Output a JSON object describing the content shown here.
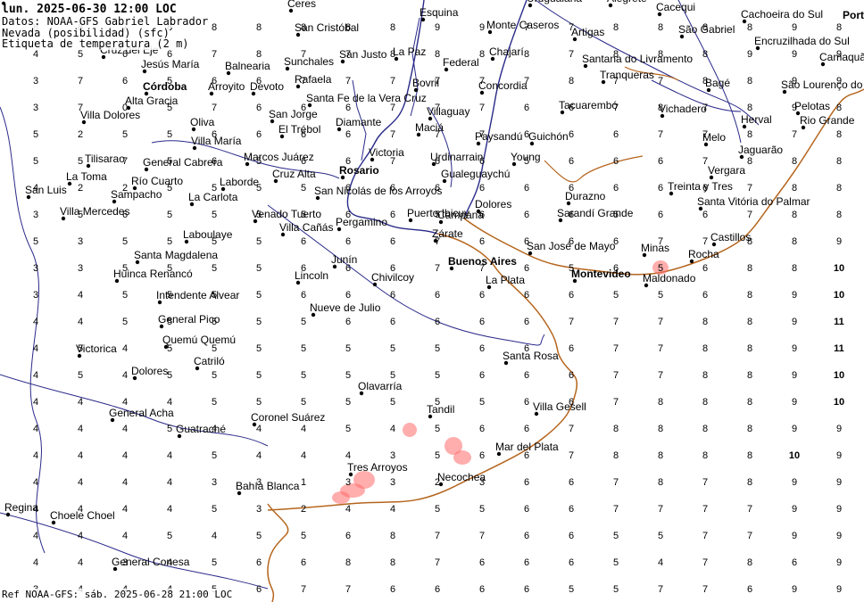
{
  "header": {
    "line1": "lun. 2025-06-30 12:00 LOC",
    "line2": "Datos: NOAA-GFS  Gabriel Labrador",
    "line3": "Nevada (posibilidad) (sfc)",
    "line4": "Etiqueta de temperatura (2 m)"
  },
  "footer": "Ref NOAA-GFS: sáb. 2025-06-28 21:00 LOC",
  "corner_label": "Port",
  "colors": {
    "background": "#ffffff",
    "river": "#2a2a8a",
    "coast": "#b5651d",
    "snow": "#ff6a6a",
    "city_dot": "#000000",
    "text": "#000000"
  },
  "cities": [
    {
      "name": "Ceres",
      "major": false
    },
    {
      "name": "Esquina",
      "major": false
    },
    {
      "name": "Uruguaiana",
      "major": false
    },
    {
      "name": "Alegrete",
      "major": false
    },
    {
      "name": "Cacequi",
      "major": false
    },
    {
      "name": "Cachoeira do Sul",
      "major": false
    },
    {
      "name": "San Cristóbal",
      "major": false
    },
    {
      "name": "Monte Caseros",
      "major": false
    },
    {
      "name": "Artigas",
      "major": false
    },
    {
      "name": "São Gabriel",
      "major": false
    },
    {
      "name": "Encruzilhada do Sul",
      "major": false
    },
    {
      "name": "Cruz del Eje",
      "major": false
    },
    {
      "name": "San Justo",
      "major": false
    },
    {
      "name": "La Paz",
      "major": false
    },
    {
      "name": "Chajarí",
      "major": false
    },
    {
      "name": "Camaquã",
      "major": false
    },
    {
      "name": "Jesús María",
      "major": false
    },
    {
      "name": "Balnearia",
      "major": false
    },
    {
      "name": "Sunchales",
      "major": false
    },
    {
      "name": "Federal",
      "major": false
    },
    {
      "name": "Santana do Livramento",
      "major": false
    },
    {
      "name": "Córdoba",
      "major": true
    },
    {
      "name": "Arroyito",
      "major": false
    },
    {
      "name": "Devoto",
      "major": false
    },
    {
      "name": "Rafaela",
      "major": false
    },
    {
      "name": "Bovril",
      "major": false
    },
    {
      "name": "Concordia",
      "major": false
    },
    {
      "name": "Tranqueras",
      "major": false
    },
    {
      "name": "Bagé",
      "major": false
    },
    {
      "name": "São Lourenço do",
      "major": false
    },
    {
      "name": "Alta Gracia",
      "major": false
    },
    {
      "name": "Santa Fe de la Vera Cruz",
      "major": false
    },
    {
      "name": "Villaguay",
      "major": false
    },
    {
      "name": "Tacuarembó",
      "major": false
    },
    {
      "name": "Pelotas",
      "major": false
    },
    {
      "name": "Villa Dolores",
      "major": false
    },
    {
      "name": "San Jorge",
      "major": false
    },
    {
      "name": "Vichadero",
      "major": false
    },
    {
      "name": "Herval",
      "major": false
    },
    {
      "name": "Rio Grande",
      "major": false
    },
    {
      "name": "Oliva",
      "major": false
    },
    {
      "name": "Diamante",
      "major": false
    },
    {
      "name": "Maciá",
      "major": false
    },
    {
      "name": "Mina Clavero",
      "major": false
    },
    {
      "name": "El Trébol",
      "major": false
    },
    {
      "name": "Paysandú",
      "major": false
    },
    {
      "name": "Guichón",
      "major": false
    },
    {
      "name": "Melo",
      "major": false
    },
    {
      "name": "Villa María",
      "major": false
    },
    {
      "name": "Jaguarão",
      "major": false
    },
    {
      "name": "Tilisarao",
      "major": false
    },
    {
      "name": "General Cabrera",
      "major": false
    },
    {
      "name": "Marcos Juárez",
      "major": false
    },
    {
      "name": "Victoria",
      "major": false
    },
    {
      "name": "Urdinarrain",
      "major": false
    },
    {
      "name": "Young",
      "major": false
    },
    {
      "name": "Rosario",
      "major": true
    },
    {
      "name": "Gualeguaychú",
      "major": false
    },
    {
      "name": "Vergara",
      "major": false
    },
    {
      "name": "La Toma",
      "major": false
    },
    {
      "name": "Cruz Alta",
      "major": false
    },
    {
      "name": "Río Cuarto",
      "major": false
    },
    {
      "name": "Laborde",
      "major": false
    },
    {
      "name": "Treinta y Tres",
      "major": false
    },
    {
      "name": "San Luis",
      "major": false
    },
    {
      "name": "San Nicolás de los Arroyos",
      "major": false
    },
    {
      "name": "Sampacho",
      "major": false
    },
    {
      "name": "La Carlota",
      "major": false
    },
    {
      "name": "Durazno",
      "major": false
    },
    {
      "name": "Dolores",
      "major": false
    },
    {
      "name": "Santa Vitória do Palmar",
      "major": false
    },
    {
      "name": "Villa Mercedes",
      "major": false
    },
    {
      "name": "Venado Tuerto",
      "major": false
    },
    {
      "name": "Puerto Ibicuy",
      "major": false
    },
    {
      "name": "Sarandí Grande",
      "major": false
    },
    {
      "name": "Villa Cañás",
      "major": false
    },
    {
      "name": "Pergamino",
      "major": false
    },
    {
      "name": "Campana",
      "major": false
    },
    {
      "name": "Zárate",
      "major": false
    },
    {
      "name": "Laboulaye",
      "major": false
    },
    {
      "name": "San José de Mayo",
      "major": false
    },
    {
      "name": "Minas",
      "major": false
    },
    {
      "name": "Castillos",
      "major": false
    },
    {
      "name": "Santa Magdalena",
      "major": false
    },
    {
      "name": "Junín",
      "major": false
    },
    {
      "name": "Buenos Aires",
      "major": true
    },
    {
      "name": "Rocha",
      "major": false
    },
    {
      "name": "Huinca Renancó",
      "major": false
    },
    {
      "name": "Lincoln",
      "major": false
    },
    {
      "name": "Chivilcoy",
      "major": false
    },
    {
      "name": "La Plata",
      "major": false
    },
    {
      "name": "Montevideo",
      "major": true
    },
    {
      "name": "Maldonado",
      "major": false
    },
    {
      "name": "Intendente Alvear",
      "major": false
    },
    {
      "name": "Nueve de Julio",
      "major": false
    },
    {
      "name": "General Pico",
      "major": false
    },
    {
      "name": "Quemú Quemú",
      "major": false
    },
    {
      "name": "Victorica",
      "major": false
    },
    {
      "name": "Catriló",
      "major": false
    },
    {
      "name": "Dolores",
      "major": false
    },
    {
      "name": "Santa Rosa",
      "major": false
    },
    {
      "name": "Olavarría",
      "major": false
    },
    {
      "name": "Villa Gesell",
      "major": false
    },
    {
      "name": "General Acha",
      "major": false
    },
    {
      "name": "Tandil",
      "major": false
    },
    {
      "name": "Coronel Suárez",
      "major": false
    },
    {
      "name": "Guatraché",
      "major": false
    },
    {
      "name": "Mar del Plata",
      "major": false
    },
    {
      "name": "Tres Arroyos",
      "major": false
    },
    {
      "name": "Necochea",
      "major": false
    },
    {
      "name": "Bahía Blanca",
      "major": false
    },
    {
      "name": "Choele Choel",
      "major": false
    },
    {
      "name": "Regina",
      "major": false
    },
    {
      "name": "General Conesa",
      "major": false
    }
  ],
  "temperature_grid": {
    "rows": [
      [
        "8",
        "8",
        "7",
        "8",
        "8",
        "8",
        "8",
        "8",
        "8",
        "9",
        "9",
        "7",
        "7",
        "8",
        "8",
        "8",
        "8",
        "9",
        "8"
      ],
      [
        "4",
        "5",
        "6",
        "6",
        "7",
        "8",
        "7",
        "7",
        "8",
        "8",
        "8",
        "8",
        "7",
        "8",
        "8",
        "8",
        "9",
        "9",
        "9"
      ],
      [
        "3",
        "7",
        "6",
        "5",
        "6",
        "6",
        "7",
        "7",
        "7",
        "7",
        "7",
        "7",
        "8",
        "7",
        "7",
        "8",
        "8",
        "9",
        "9"
      ],
      [
        "3",
        "7",
        "0",
        "5",
        "7",
        "6",
        "6",
        "6",
        "7",
        "7",
        "7",
        "6",
        "6",
        "7",
        "8",
        "7",
        "8",
        "9",
        "8"
      ],
      [
        "5",
        "2",
        "5",
        "5",
        "6",
        "6",
        "6",
        "6",
        "7",
        "7",
        "7",
        "6",
        "6",
        "6",
        "7",
        "7",
        "8",
        "7",
        "8"
      ],
      [
        "5",
        "5",
        "7",
        "5",
        "6",
        "5",
        "6",
        "6",
        "7",
        "6",
        "6",
        "5",
        "6",
        "6",
        "6",
        "7",
        "8",
        "8",
        "8"
      ],
      [
        "4",
        "2",
        "2",
        "5",
        "5",
        "5",
        "5",
        "6",
        "6",
        "6",
        "6",
        "6",
        "6",
        "6",
        "6",
        "6",
        "7",
        "8",
        "8"
      ],
      [
        "3",
        "5",
        "6",
        "5",
        "5",
        "5",
        "5",
        "6",
        "6",
        "5",
        "6",
        "6",
        "6",
        "5",
        "6",
        "6",
        "7",
        "8",
        "8"
      ],
      [
        "5",
        "3",
        "5",
        "5",
        "5",
        "5",
        "6",
        "6",
        "6",
        "7",
        "6",
        "6",
        "6",
        "6",
        "7",
        "7",
        "8",
        "8",
        "9"
      ],
      [
        "3",
        "3",
        "5",
        "5",
        "5",
        "5",
        "6",
        "6",
        "6",
        "7",
        "7",
        "6",
        "5",
        "6",
        "5",
        "6",
        "8",
        "8",
        "10"
      ],
      [
        "3",
        "4",
        "5",
        "5",
        "5",
        "5",
        "6",
        "6",
        "6",
        "6",
        "6",
        "6",
        "6",
        "5",
        "5",
        "6",
        "8",
        "9",
        "10"
      ],
      [
        "4",
        "4",
        "5",
        "5",
        "5",
        "5",
        "5",
        "6",
        "6",
        "6",
        "6",
        "6",
        "7",
        "7",
        "7",
        "8",
        "8",
        "9",
        "11"
      ],
      [
        "4",
        "5",
        "4",
        "5",
        "5",
        "5",
        "5",
        "5",
        "5",
        "5",
        "6",
        "6",
        "6",
        "7",
        "7",
        "8",
        "8",
        "9",
        "11"
      ],
      [
        "4",
        "5",
        "4",
        "5",
        "5",
        "5",
        "5",
        "5",
        "5",
        "5",
        "6",
        "6",
        "6",
        "7",
        "7",
        "8",
        "8",
        "9",
        "10"
      ],
      [
        "4",
        "4",
        "4",
        "4",
        "5",
        "5",
        "5",
        "5",
        "5",
        "5",
        "5",
        "6",
        "6",
        "7",
        "8",
        "8",
        "8",
        "9",
        "10"
      ],
      [
        "4",
        "4",
        "4",
        "5",
        "4",
        "4",
        "4",
        "5",
        "4",
        "5",
        "6",
        "6",
        "7",
        "8",
        "8",
        "8",
        "8",
        "9",
        "9"
      ],
      [
        "4",
        "4",
        "4",
        "4",
        "5",
        "4",
        "4",
        "4",
        "3",
        "5",
        "6",
        "6",
        "7",
        "8",
        "8",
        "8",
        "8",
        "10",
        "9"
      ],
      [
        "4",
        "4",
        "4",
        "4",
        "3",
        "3",
        "1",
        "3",
        "3",
        "2",
        "3",
        "6",
        "6",
        "7",
        "8",
        "7",
        "8",
        "9",
        "9"
      ],
      [
        "4",
        "4",
        "4",
        "4",
        "5",
        "3",
        "2",
        "4",
        "4",
        "5",
        "5",
        "6",
        "6",
        "7",
        "7",
        "7",
        "7",
        "9",
        "9"
      ],
      [
        "4",
        "4",
        "4",
        "5",
        "4",
        "5",
        "5",
        "6",
        "8",
        "7",
        "7",
        "6",
        "6",
        "5",
        "5",
        "7",
        "7",
        "9",
        "9"
      ],
      [
        "4",
        "4",
        "3",
        "4",
        "5",
        "6",
        "6",
        "8",
        "8",
        "7",
        "6",
        "6",
        "6",
        "5",
        "4",
        "7",
        "8",
        "6",
        "9"
      ],
      [
        "3",
        "4",
        "4",
        "4",
        "5",
        "6",
        "7",
        "7",
        "6",
        "6",
        "6",
        "6",
        "5",
        "5",
        "7",
        "7",
        "6",
        "9",
        "9"
      ],
      [
        "4",
        "4",
        "4",
        "4",
        "6",
        "6",
        "6",
        "7",
        "6",
        "6",
        "6",
        "6",
        "5",
        "5",
        "8",
        "7",
        "9",
        "8",
        "9"
      ]
    ]
  }
}
